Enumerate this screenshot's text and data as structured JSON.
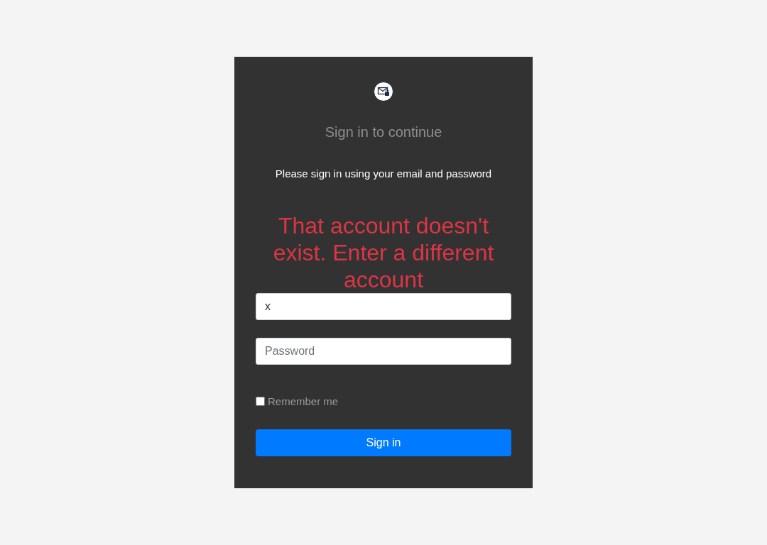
{
  "title": "Sign in to continue",
  "instruction": "Please sign in using your email and password",
  "error": "That account doesn't exist. Enter a different account",
  "email": {
    "value": "x"
  },
  "password": {
    "placeholder": "Password"
  },
  "remember": {
    "label": "Remember me",
    "checked": false
  },
  "button": "Sign in"
}
